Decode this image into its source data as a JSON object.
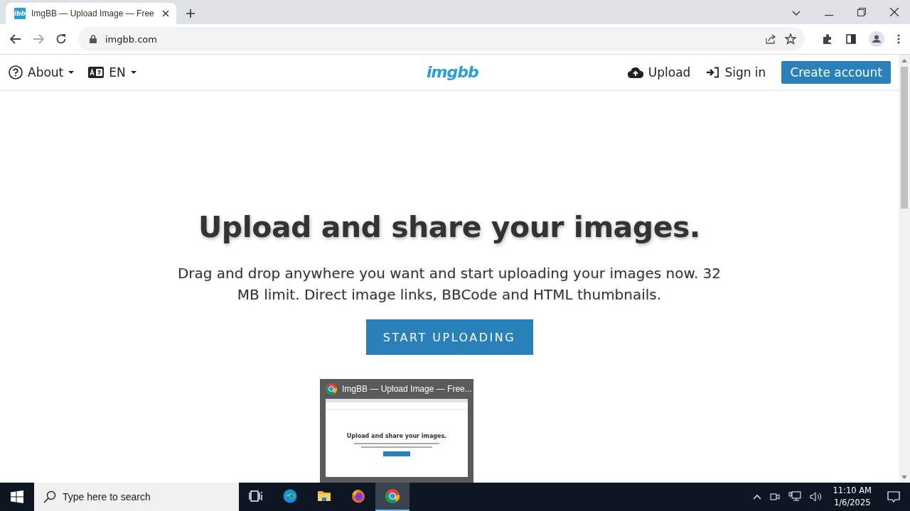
{
  "browser": {
    "tab": {
      "favicon": "ibb",
      "title": "ImgBB — Upload Image — Free"
    },
    "address": "imgbb.com"
  },
  "header": {
    "about": "About",
    "language": "EN",
    "logo": "imgbb",
    "upload": "Upload",
    "sign_in": "Sign in",
    "create_account": "Create account"
  },
  "hero": {
    "title": "Upload and share your images.",
    "text": "Drag and drop anywhere you want and start uploading your images now. 32 MB limit. Direct image links, BBCode and HTML thumbnails.",
    "button": "START UPLOADING"
  },
  "taskbar_preview": {
    "title": "ImgBB — Upload Image — Free...",
    "heading": "Upload and share your images."
  },
  "taskbar": {
    "search": {
      "placeholder": "Type here to search"
    },
    "apps": [
      {
        "kind": "taskview",
        "selected": false
      },
      {
        "kind": "edge",
        "selected": false
      },
      {
        "kind": "files",
        "selected": false
      },
      {
        "kind": "firefox",
        "selected": false
      },
      {
        "kind": "chrome",
        "selected": true
      }
    ],
    "time": "11:10 AM",
    "date": "1/6/2025"
  }
}
